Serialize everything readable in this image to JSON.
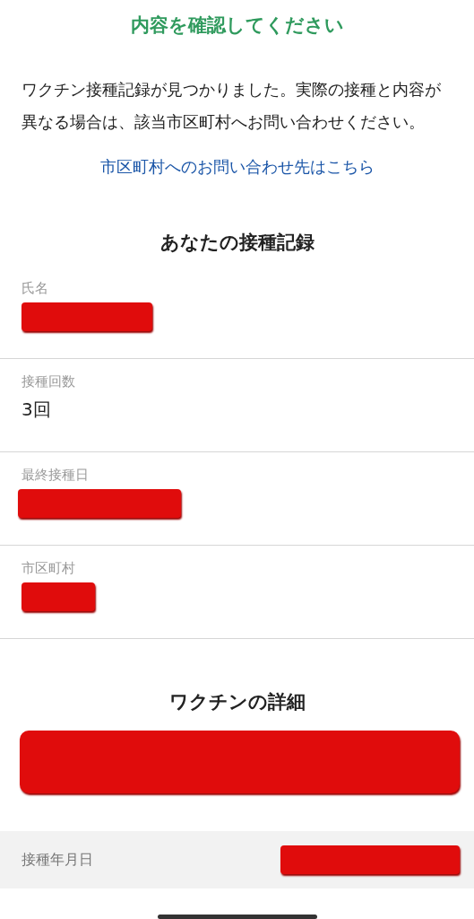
{
  "title": "内容を確認してください",
  "message": "ワクチン接種記録が見つかりました。実際の接種と内容が異なる場合は、該当市区町村へお問い合わせください。",
  "contact_link": "市区町村へのお問い合わせ先はこちら",
  "record": {
    "heading": "あなたの接種記録",
    "fields": [
      {
        "label": "氏名",
        "redacted": true
      },
      {
        "label": "接種回数",
        "value": "3回",
        "redacted": false
      },
      {
        "label": "最終接種日",
        "redacted": true
      },
      {
        "label": "市区町村",
        "redacted": true
      }
    ]
  },
  "details": {
    "heading": "ワクチンの詳細",
    "banner_redacted": true,
    "rows": [
      {
        "label": "接種年月日",
        "redacted": true
      }
    ]
  }
}
